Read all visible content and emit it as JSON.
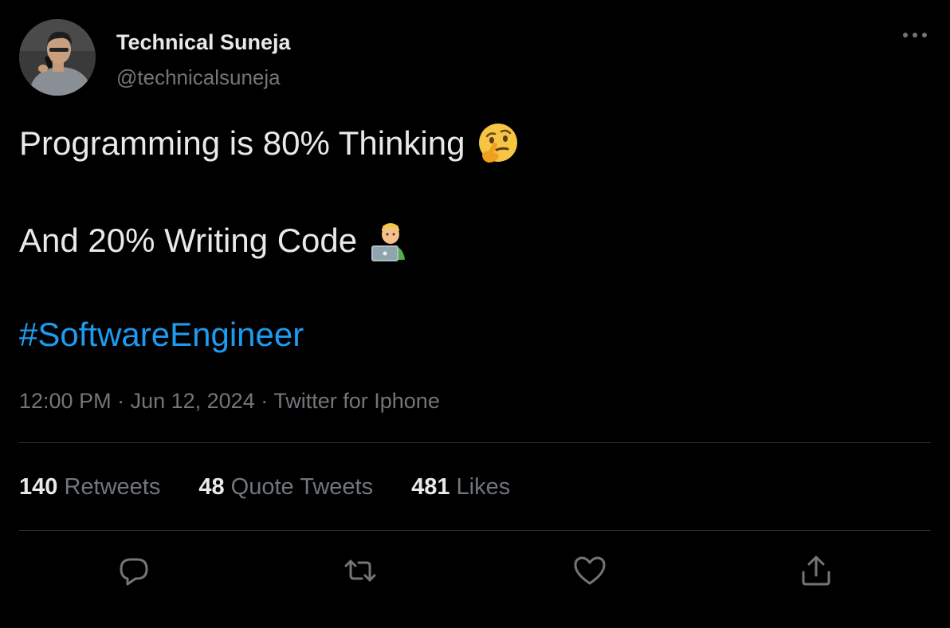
{
  "author": {
    "name": "Technical Suneja",
    "handle": "@technicalsuneja"
  },
  "tweet": {
    "line1": "Programming is 80% Thinking",
    "line2": "And 20% Writing Code",
    "hashtag": "#SoftwareEngineer",
    "emoji_line1": "thinking-face-emoji",
    "emoji_line2": "technologist-emoji"
  },
  "meta": {
    "time": "12:00 PM",
    "separator": " · ",
    "date": "Jun 12, 2024",
    "source": "Twitter for Iphone"
  },
  "stats": [
    {
      "count": "140",
      "label": "Retweets"
    },
    {
      "count": "48",
      "label": "Quote Tweets"
    },
    {
      "count": "481",
      "label": "Likes"
    }
  ],
  "actions": [
    "reply-icon",
    "retweet-icon",
    "like-icon",
    "share-icon"
  ],
  "colors": {
    "background": "#000000",
    "text": "#e7e9ea",
    "secondary": "#71767b",
    "accent": "#1d9bf0",
    "divider": "#2f3336"
  }
}
